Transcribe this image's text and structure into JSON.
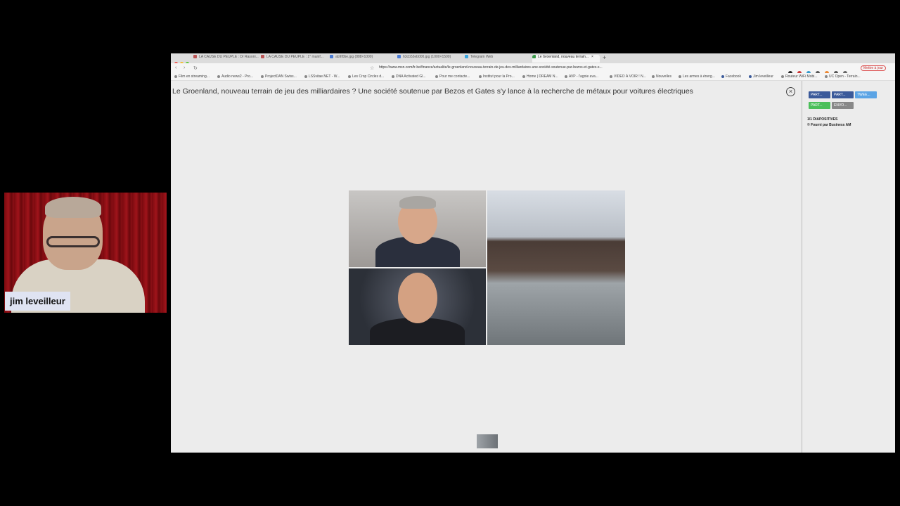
{
  "webcam": {
    "name": "jim leveilleur"
  },
  "tabs": [
    {
      "label": "LA CAUSE DU PEUPLE : Dr Rasoni..."
    },
    {
      "label": "LA CAUSE DU PEUPLE : 1° manif..."
    },
    {
      "label": "ab9f0be.jpg (888×1000)"
    },
    {
      "label": "63cb52eb000.jpg (1000×1500)"
    },
    {
      "label": "Telegram Web"
    },
    {
      "label": "Le Groenland, nouveau terrain..."
    }
  ],
  "toolbar": {
    "url": "https://www.msn.com/fr-be/finance/actualite/le-groenland-nouveau-terrain-de-jeu-des-milliardaires-une-société-soutenue-par-bezos-et-gates-s...",
    "update_label": "Mettre à jour"
  },
  "bookmarks": [
    "Film en streaming...",
    "Audio news2 - Pro...",
    "ProjectDAN Swiss...",
    "LSSvitae.NET - W...",
    "Les Crop Circles d...",
    "DNA Activated Gl...",
    "Pour me contacte...",
    "Institut pour la Pro...",
    "Home | DREAM N...",
    "AVP - l'agoie ava...",
    "VIDEO À VOIR ! N...",
    "Nouvelles",
    "Les armes à énerg...",
    "Facebook",
    "Jim leveilleur",
    "Routeur WiFi Mobi...",
    "UC Open - Terrain..."
  ],
  "article": {
    "title": "Le Groenland, nouveau terrain de jeu des milliardaires ? Une société soutenue par Bezos et Gates s'y lance à la recherche de métaux pour voitures électriques",
    "close_icon": "×"
  },
  "share": {
    "buttons": [
      "PART...",
      "PART...",
      "TWEE...",
      "PART...",
      "ENVO..."
    ],
    "colors": [
      "#3b5a9a",
      "#3b5a9a",
      "#5ba4e5",
      "#4bbf5a",
      "#888888"
    ]
  },
  "slideshow": {
    "counter": "1/1 DIAPOSITIVES",
    "credit": "© Fourni par Business AM"
  }
}
